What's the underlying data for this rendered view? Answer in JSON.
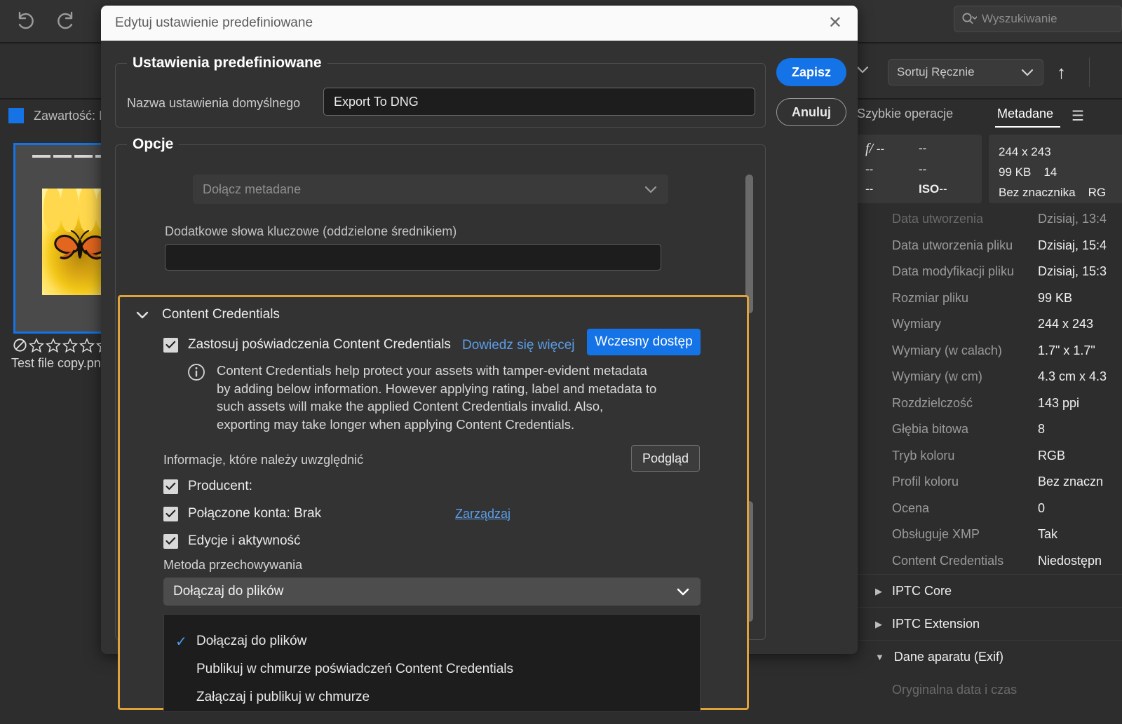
{
  "app": {
    "toolbar": {
      "undo_label": "undo",
      "redo_label": "redo",
      "search_placeholder": "Wyszukiwanie",
      "sort_value": "Sortuj Ręcznie",
      "sort_direction": "↑",
      "content_label": "Zawartość: I"
    },
    "thumbnail": {
      "filename": "Test file copy.pn",
      "rating": "0",
      "stars": 5
    }
  },
  "right_panel": {
    "tabs": [
      {
        "label": "Szybkie operacje",
        "active": false
      },
      {
        "label": "Metadane",
        "active": true
      }
    ],
    "menu_icon": "hamburger-icon",
    "exif_summary": {
      "aperture": "--",
      "shutter": "--",
      "focal": "--",
      "exposure": "--",
      "ev": "--",
      "iso_label": "ISO",
      "iso": "--"
    },
    "file_summary": {
      "dimensions": "244 x 243",
      "file_size": "99 KB",
      "ppi": "14",
      "color_profile": "Bez znacznika",
      "color_mode": "RG"
    },
    "metadata_rows": [
      {
        "key": "Data utworzenia",
        "value": "Dzisiaj, 13:4",
        "faded": true
      },
      {
        "key": "Data utworzenia pliku",
        "value": "Dzisiaj, 15:4",
        "faded": false
      },
      {
        "key": "Data modyfikacji pliku",
        "value": "Dzisiaj, 15:3",
        "faded": false
      },
      {
        "key": "Rozmiar pliku",
        "value": "99 KB",
        "faded": false
      },
      {
        "key": "Wymiary",
        "value": "244 x 243",
        "faded": false
      },
      {
        "key": "Wymiary (w calach)",
        "value": "1.7\" x 1.7\"",
        "faded": false
      },
      {
        "key": "Wymiary (w cm)",
        "value": "4.3 cm x 4.3",
        "faded": false
      },
      {
        "key": "Rozdzielczość",
        "value": "143 ppi",
        "faded": false
      },
      {
        "key": "Głębia bitowa",
        "value": "8",
        "faded": false
      },
      {
        "key": "Tryb koloru",
        "value": "RGB",
        "faded": false
      },
      {
        "key": "Profil koloru",
        "value": "Bez znaczn",
        "faded": false
      },
      {
        "key": "Ocena",
        "value": "0",
        "faded": false
      },
      {
        "key": "Obsługuje XMP",
        "value": "Tak",
        "faded": false
      },
      {
        "key": "Content Credentials",
        "value": "Niedostępn",
        "faded": false
      }
    ],
    "groups": [
      {
        "label": "IPTC Core",
        "expanded": false
      },
      {
        "label": "IPTC Extension",
        "expanded": false
      },
      {
        "label": "Dane aparatu (Exif)",
        "expanded": true
      }
    ],
    "exif_first_row": "Oryginalna data i czas"
  },
  "dialog": {
    "title": "Edytuj ustawienie predefiniowane",
    "close_label": "✕",
    "preset": {
      "legend": "Ustawienia predefiniowane",
      "name_label": "Nazwa ustawienia domyślnego",
      "name_value": "Export To DNG"
    },
    "buttons": {
      "save": "Zapisz",
      "cancel": "Anuluj"
    },
    "options": {
      "legend": "Opcje",
      "metadata_select": "Dołącz metadane",
      "keywords_label": "Dodatkowe słowa kluczowe (oddzielone średnikiem)",
      "keywords_value": ""
    },
    "content_credentials": {
      "section_title": "Content Credentials",
      "apply_label": "Zastosuj poświadczenia Content Credentials",
      "apply_checked": true,
      "learn_more": "Dowiedz się więcej",
      "early_access": "Wczesny dostęp",
      "info_text": "Content Credentials help protect your assets with tamper-evident metadata by adding below information. However applying rating, label and metadata to such assets will make the applied Content Credentials invalid. Also, exporting may take longer when applying Content Credentials.",
      "include_label": "Informacje, które należy uwzględnić",
      "preview_button": "Podgląd",
      "checkboxes": [
        {
          "label": "Producent:",
          "checked": true
        },
        {
          "label": "Połączone konta: Brak",
          "checked": true
        },
        {
          "label": "Edycje i aktywność",
          "checked": true
        }
      ],
      "manage_link": "Zarządzaj",
      "storage_label": "Metoda przechowywania",
      "storage_value": "Dołączaj do plików",
      "storage_options": [
        {
          "label": "Dołączaj do plików",
          "selected": true
        },
        {
          "label": "Publikuj w chmurze poświadczeń Content Credentials",
          "selected": false
        },
        {
          "label": "Załączaj i publikuj w chmurze",
          "selected": false
        }
      ]
    }
  },
  "colors": {
    "accent_blue": "#1473e6",
    "highlight_orange": "#e0a33c",
    "link_blue": "#5b9ee8",
    "panel_bg": "#323232"
  }
}
